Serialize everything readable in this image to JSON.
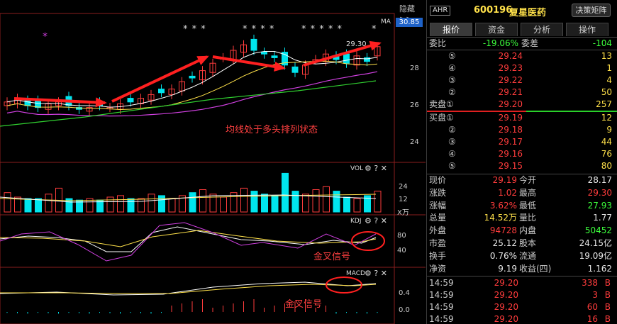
{
  "chart": {
    "hide_label": "隐藏>>",
    "price_tag": "30.85",
    "ma_label": "MA",
    "high_label": "29.30",
    "price_axis": [
      "28",
      "26",
      "24"
    ],
    "vol_title": "VOL",
    "vol_axis": [
      "24",
      "12"
    ],
    "vol_unit": "X万",
    "kdj_title": "KDJ",
    "kdj_axis": [
      "80",
      "40"
    ],
    "macd_title": "MACD",
    "macd_axis": [
      "0.4",
      "0.0"
    ],
    "annot_ma": "均线处于多头排列状态",
    "annot_kdj": "金叉信号",
    "annot_macd": "金叉信号",
    "stars": [
      "* * *",
      "* * * *",
      "* * * * *",
      "*"
    ],
    "purple_star": "*"
  },
  "header": {
    "badge": "AHR",
    "code": "600196",
    "name": "复星医药",
    "decide_button": "决策矩阵"
  },
  "tabs": [
    "报价",
    "资金",
    "分析",
    "操作"
  ],
  "ratio": {
    "wb_label": "委比",
    "wb_value": "-19.06%",
    "wc_label": "委差",
    "wc_value": "-104"
  },
  "asks": [
    {
      "n": "⑤",
      "price": "29.24",
      "vol": "13"
    },
    {
      "n": "④",
      "price": "29.23",
      "vol": "1"
    },
    {
      "n": "③",
      "price": "29.22",
      "vol": "4"
    },
    {
      "n": "②",
      "price": "29.21",
      "vol": "50"
    },
    {
      "n": "卖盘①",
      "price": "29.20",
      "vol": "257"
    }
  ],
  "bids": [
    {
      "n": "买盘①",
      "price": "29.19",
      "vol": "12"
    },
    {
      "n": "②",
      "price": "29.18",
      "vol": "9"
    },
    {
      "n": "③",
      "price": "29.17",
      "vol": "44"
    },
    {
      "n": "④",
      "price": "29.16",
      "vol": "76"
    },
    {
      "n": "⑤",
      "price": "29.15",
      "vol": "80"
    }
  ],
  "stats": [
    {
      "l1": "现价",
      "v1": "29.19",
      "c1": "red",
      "l2": "今开",
      "v2": "28.17",
      "c2": "white"
    },
    {
      "l1": "涨跌",
      "v1": "1.02",
      "c1": "red",
      "l2": "最高",
      "v2": "29.30",
      "c2": "red"
    },
    {
      "l1": "涨幅",
      "v1": "3.62%",
      "c1": "red",
      "l2": "最低",
      "v2": "27.93",
      "c2": "green"
    },
    {
      "l1": "总量",
      "v1": "14.52万",
      "c1": "yellow",
      "l2": "量比",
      "v2": "1.77",
      "c2": "white"
    },
    {
      "l1": "外盘",
      "v1": "94728",
      "c1": "red",
      "l2": "内盘",
      "v2": "50452",
      "c2": "green"
    },
    {
      "l1": "市盈",
      "v1": "25.12",
      "c1": "white",
      "l2": "股本",
      "v2": "24.15亿",
      "c2": "white"
    },
    {
      "l1": "换手",
      "v1": "0.76%",
      "c1": "white",
      "l2": "流通",
      "v2": "19.09亿",
      "c2": "white"
    },
    {
      "l1": "净资",
      "v1": "9.19",
      "c1": "white",
      "l2": "收益(四)",
      "v2": "1.162",
      "c2": "white"
    }
  ],
  "ticks": [
    {
      "time": "14:59",
      "price": "29.20",
      "vol": "338",
      "side": "B"
    },
    {
      "time": "14:59",
      "price": "29.20",
      "vol": "3",
      "side": "B"
    },
    {
      "time": "14:59",
      "price": "29.20",
      "vol": "60",
      "side": "B"
    },
    {
      "time": "14:59",
      "price": "29.20",
      "vol": "16",
      "side": "B"
    }
  ],
  "colors": {
    "up": "#ff3c3c",
    "down": "#00e5ee",
    "ma5": "#ffffff",
    "ma10": "#ffe14a",
    "ma20": "#d040e0",
    "ma60": "#30d030",
    "arrow": "#ff2020"
  }
}
